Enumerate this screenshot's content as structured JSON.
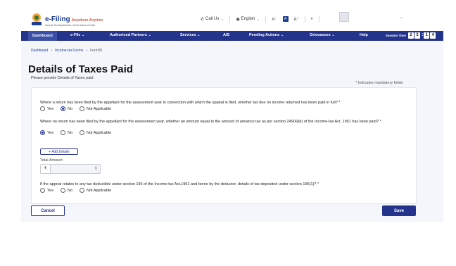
{
  "header": {
    "logo_main": "e-Filing",
    "logo_tag": "Anywhere Anytime",
    "logo_sub": "Income Tax Department, Government of India",
    "call_us": "Call Us",
    "language": "English",
    "font_decrease": "A⁻",
    "font_normal": "A",
    "font_increase": "A⁺",
    "contrast_icon": "contrast-icon"
  },
  "nav": {
    "items": [
      "Dashboard",
      "e-File",
      "Authorised Partners",
      "Services",
      "AIS",
      "Pending Actions",
      "Grievances",
      "Help"
    ],
    "session_label": "Session Time",
    "session_digits": [
      "2",
      "3",
      "1",
      "4"
    ],
    "session_colon": ":"
  },
  "breadcrumb": [
    "Dashboard",
    "Income-tax Forms",
    "Form35"
  ],
  "page": {
    "title": "Details of Taxes Paid",
    "subtitle": "Please provide Details of Taxes paid",
    "mandatory_note": "* Indicates mandatory fields"
  },
  "questions": [
    {
      "text": "Where a return has been filed by the appellant for the assessment year in connection with which the appeal is filed, whether tax due on income returned has been paid in full? *",
      "options": [
        "Yes",
        "No",
        "Not Applicable"
      ],
      "selected": 1
    },
    {
      "text": "Where no return has been filed by the appellant for the assessment year, whether an amount equal to the amount of advance tax as per section 249(4)(b) of the Income-tax Act, 1961 has been paid? *",
      "options": [
        "Yes",
        "No",
        "Not Applicable"
      ],
      "selected": 0
    },
    {
      "text": "If the appeal relates to any tax deductible under section 195 of the Income-tax Act,1961 and borne by the deductor, details of tax deposited under section 195(1)? *",
      "options": [
        "Yes",
        "No",
        "Not Applicable"
      ],
      "selected": -1
    }
  ],
  "add_details": "+ Add Details",
  "total_amount": {
    "label": "Total Amount",
    "currency": "₹",
    "value": "0"
  },
  "buttons": {
    "cancel": "Cancel",
    "save": "Save"
  }
}
